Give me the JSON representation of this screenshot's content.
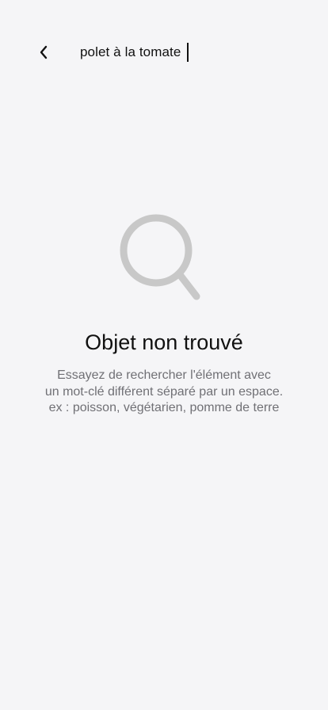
{
  "header": {
    "back_icon": "chevron-left-icon",
    "search": {
      "value": "polet à la tomate"
    }
  },
  "empty_state": {
    "icon": "search-icon",
    "title": "Objet non trouvé",
    "message_lines": [
      "Essayez de rechercher l'élément avec",
      "un mot-clé différent séparé par un espace.",
      "ex : poisson, végétarien, pomme de terre"
    ]
  },
  "colors": {
    "background": "#f5f5f7",
    "icon_gray": "#c8c8c8",
    "text_primary": "#111111",
    "text_secondary": "#707075"
  }
}
